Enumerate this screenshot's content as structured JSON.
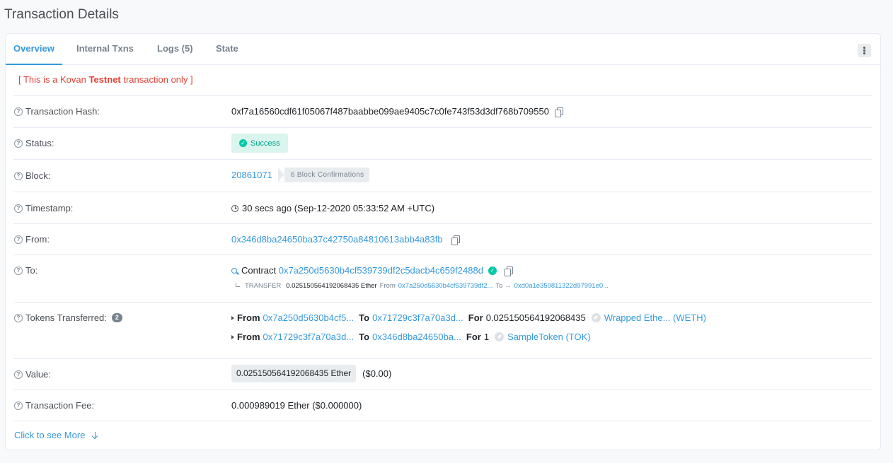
{
  "page_title": "Transaction Details",
  "tabs": [
    {
      "label": "Overview"
    },
    {
      "label": "Internal Txns"
    },
    {
      "label": "Logs (5)"
    },
    {
      "label": "State"
    }
  ],
  "notice": {
    "open": "[ This is a Kovan ",
    "bold": "Testnet",
    "close": " transaction only ]"
  },
  "rows": {
    "hash": {
      "label": "Transaction Hash:",
      "value": "0xf7a16560cdf61f05067f487baabbe099ae9405c7c0fe743f53d3df768b709550"
    },
    "status": {
      "label": "Status:",
      "value": "Success"
    },
    "block": {
      "label": "Block:",
      "number": "20861071",
      "confirmations": "6 Block Confirmations"
    },
    "timestamp": {
      "label": "Timestamp:",
      "value": "30 secs ago (Sep-12-2020 05:33:52 AM +UTC)"
    },
    "from": {
      "label": "From:",
      "address": "0x346d8ba24650ba37c42750a84810613abb4a83fb"
    },
    "to": {
      "label": "To:",
      "prefix": "Contract",
      "address": "0x7a250d5630b4cf539739df2c5dacb4c659f2488d",
      "transfer": {
        "type": "TRANSFER",
        "amount": "0.025150564192068435 Ether",
        "from_label": "From",
        "from_address": "0x7a250d5630b4cf539739df2...",
        "to_label": "To →",
        "to_address": "0xd0a1e359811322d97991e0..."
      }
    },
    "tokens": {
      "label": "Tokens Transferred:",
      "count": "2",
      "from_label": "From",
      "to_label": "To",
      "for_label": "For",
      "items": [
        {
          "from": "0x7a250d5630b4cf5...",
          "to": "0x71729c3f7a70a3d...",
          "amount": "0.025150564192068435",
          "token": "Wrapped Ethe... (WETH)"
        },
        {
          "from": "0x71729c3f7a70a3d...",
          "to": "0x346d8ba24650ba...",
          "amount": "1",
          "token": "SampleToken (TOK)"
        }
      ]
    },
    "value": {
      "label": "Value:",
      "amount": "0.025150564192068435 Ether",
      "usd": "($0.00)"
    },
    "fee": {
      "label": "Transaction Fee:",
      "value": "0.000989019 Ether ($0.000000)"
    }
  },
  "more_link": "Click to see More",
  "colors": {
    "accent": "#3498db",
    "success": "#00c9a7",
    "notice": "#de4437"
  }
}
